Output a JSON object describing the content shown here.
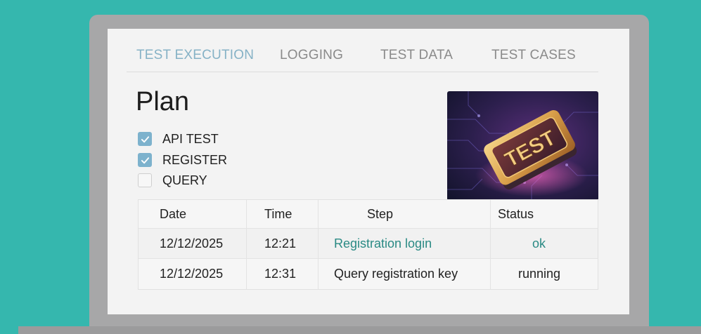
{
  "tabs": [
    {
      "label": "TEST EXECUTION",
      "active": true
    },
    {
      "label": "LOGGING",
      "active": false
    },
    {
      "label": "TEST DATA",
      "active": false
    },
    {
      "label": "TEST CASES",
      "active": false
    }
  ],
  "plan": {
    "title": "Plan",
    "options": [
      {
        "label": "API TEST",
        "checked": true
      },
      {
        "label": "REGISTER",
        "checked": true
      },
      {
        "label": "QUERY",
        "checked": false
      }
    ]
  },
  "hero_image": {
    "chip_text": "TEST"
  },
  "table": {
    "headers": [
      "Date",
      "Time",
      "Step",
      "Status"
    ],
    "rows": [
      {
        "date": "12/12/2025",
        "time": "12:21",
        "step": "Registration login",
        "status": "ok"
      },
      {
        "date": "12/12/2025",
        "time": "12:31",
        "step": "Query registration key",
        "status": "running"
      }
    ]
  },
  "colors": {
    "background": "#35b7ae",
    "active_tab": "#86b2c6",
    "checkbox": "#7db2cd",
    "link_teal": "#2a8a84"
  }
}
